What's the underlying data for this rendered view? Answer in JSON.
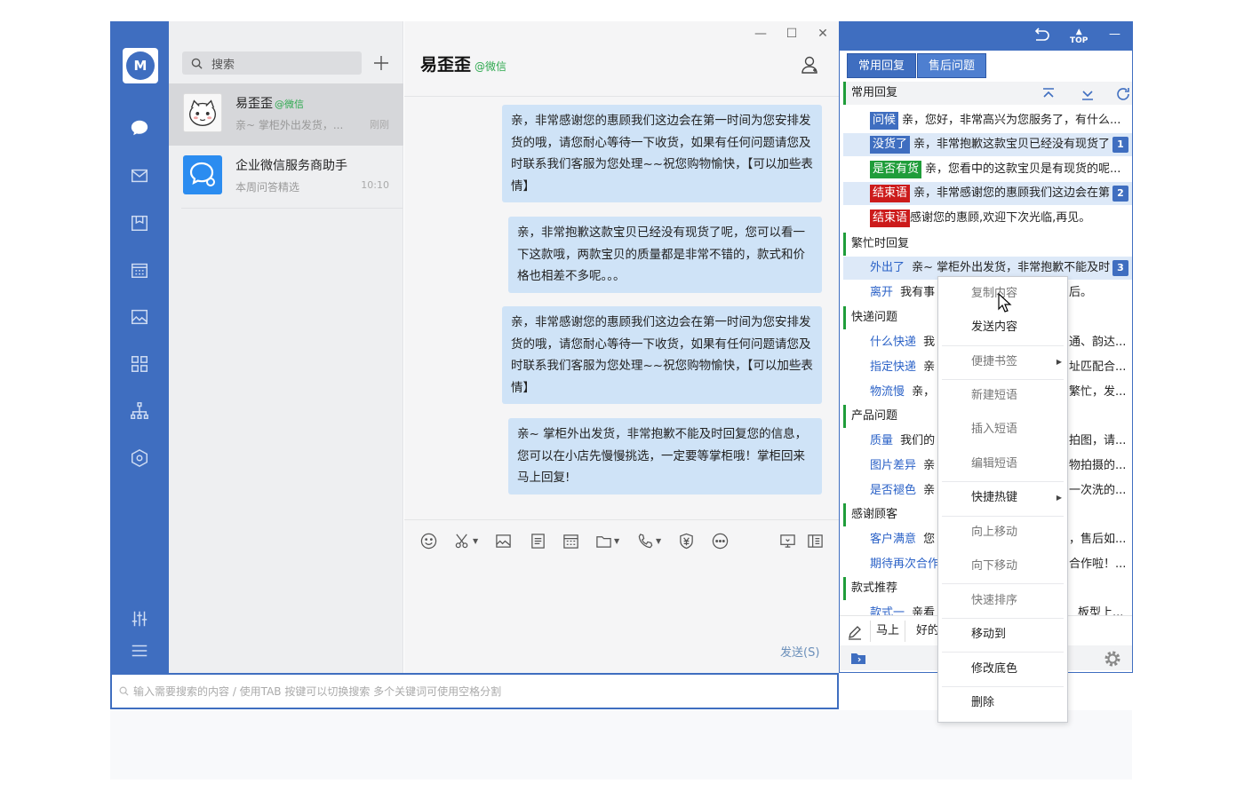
{
  "colors": {
    "accent": "#3f6ec0",
    "wechat_green": "#2ea94f",
    "bubble": "#cfe3f7",
    "tag_green": "#1f9d3a",
    "tag_red": "#cc1b1b"
  },
  "rail": {
    "logo": "M",
    "icons": [
      "chat-icon",
      "mail-icon",
      "box-icon",
      "calendar-icon",
      "image-icon",
      "apps-icon",
      "org-icon",
      "cube-icon",
      "sliders-icon",
      "menu-icon"
    ]
  },
  "convlist": {
    "search_placeholder": "搜索",
    "items": [
      {
        "name": "易歪歪",
        "tag": "@微信",
        "preview": "亲~ 掌柜外出发货，...",
        "time": "刚刚"
      },
      {
        "name": "企业微信服务商助手",
        "tag": "",
        "preview": "本周问答精选",
        "time": "10:10"
      }
    ]
  },
  "chat": {
    "title": "易歪歪",
    "title_tag": "@微信",
    "window_controls": [
      "—",
      "☐",
      "✕"
    ],
    "messages": [
      {
        "text": "亲，非常感谢您的惠顾我们这边会在第一时间为您安排发货的哦，请您耐心等待一下收货，如果有任何问题请您及时联系我们客服为您处理~~祝您购物愉快，【可以加些表情】"
      },
      {
        "text": "亲，非常抱歉这款宝贝已经没有现货了呢，您可以看一下这款哦，两款宝贝的质量都是非常不错的，款式和价格也相差不多呢。。。"
      },
      {
        "text": "亲，非常感谢您的惠顾我们这边会在第一时间为您安排发货的哦，请您耐心等待一下收货，如果有任何问题请您及时联系我们客服为您处理~~祝您购物愉快，【可以加些表情】"
      },
      {
        "text": "亲~ 掌柜外出发货，非常抱歉不能及时回复您的信息，您可以在小店先慢慢挑选，一定要等掌柜哦！掌柜回来马上回复!"
      }
    ],
    "send_label": "发送(S)"
  },
  "bottom_search": {
    "placeholder": "输入需要搜索的内容 / 使用TAB 按键可以切换搜索 多个关键词可使用空格分割"
  },
  "quick_reply": {
    "top_icons": [
      "exit-icon",
      "TOP",
      "—"
    ],
    "tabs": [
      "常用回复",
      "售后问题"
    ],
    "groups": [
      {
        "name": "常用回复",
        "items": [
          {
            "label": "问候",
            "style": "blue",
            "text": "亲，您好，非常高兴为您服务了，有什么...",
            "num": ""
          },
          {
            "label": "没货了",
            "style": "blue",
            "text": "亲，非常抱歉这款宝贝已经没有现货了",
            "num": "1"
          },
          {
            "label": "是否有货",
            "style": "green",
            "text": "亲，您看中的这款宝贝是有现货的呢...",
            "num": ""
          },
          {
            "label": "结束语",
            "style": "red",
            "text": "亲，非常感谢您的惠顾我们这边会在第",
            "num": "2"
          },
          {
            "label": "结束语",
            "style": "red",
            "text": "感谢您的惠顾,欢迎下次光临,再见。",
            "num": ""
          }
        ]
      },
      {
        "name": "繁忙时回复",
        "items": [
          {
            "label": "外出了",
            "style": "link",
            "text": "亲~ 掌柜外出发货，非常抱歉不能及时",
            "num": "3"
          },
          {
            "label": "离开",
            "style": "link",
            "text": "我有事",
            "tail": "后。",
            "num": ""
          }
        ]
      },
      {
        "name": "快递问题",
        "items": [
          {
            "label": "什么快递",
            "style": "link",
            "text": "我",
            "tail": "通、韵达...",
            "num": ""
          },
          {
            "label": "指定快递",
            "style": "link",
            "text": "亲",
            "tail": "址匹配合...",
            "num": ""
          },
          {
            "label": "物流慢",
            "style": "link",
            "text": "亲，",
            "tail": "繁忙，发...",
            "num": ""
          }
        ]
      },
      {
        "name": "产品问题",
        "items": [
          {
            "label": "质量",
            "style": "link",
            "text": "我们的",
            "tail": "拍图，请...",
            "num": ""
          },
          {
            "label": "图片差异",
            "style": "link",
            "text": "亲",
            "tail": "物拍摄的...",
            "num": ""
          },
          {
            "label": "是否褪色",
            "style": "link",
            "text": "亲",
            "tail": "一次洗的...",
            "num": ""
          }
        ]
      },
      {
        "name": "感谢顾客",
        "items": [
          {
            "label": "客户满意",
            "style": "link",
            "text": "您",
            "tail": "，售后如...",
            "num": ""
          },
          {
            "label": "期待再次合作",
            "style": "link",
            "text": "",
            "tail": "合作啦！...",
            "num": ""
          }
        ]
      },
      {
        "name": "款式推荐",
        "items": [
          {
            "label": "款式一",
            "style": "link",
            "text": "亲看",
            "tail": "板型上...",
            "num": ""
          }
        ]
      }
    ],
    "footer_words": [
      "马上",
      "好的"
    ]
  },
  "context_menu": {
    "items": [
      {
        "label": "复制内容",
        "dim": true,
        "submenu": false
      },
      {
        "label": "发送内容",
        "dim": false,
        "submenu": false
      },
      {
        "label": "便捷书签",
        "dim": true,
        "submenu": true
      },
      {
        "label": "新建短语",
        "dim": true,
        "submenu": false
      },
      {
        "label": "插入短语",
        "dim": true,
        "submenu": false
      },
      {
        "label": "编辑短语",
        "dim": true,
        "submenu": false
      },
      {
        "label": "快捷热键",
        "dim": false,
        "submenu": true
      },
      {
        "label": "向上移动",
        "dim": true,
        "submenu": false
      },
      {
        "label": "向下移动",
        "dim": true,
        "submenu": false
      },
      {
        "label": "快速排序",
        "dim": true,
        "submenu": false
      },
      {
        "label": "移动到",
        "dim": false,
        "submenu": false
      },
      {
        "label": "修改底色",
        "dim": false,
        "submenu": false
      },
      {
        "label": "删除",
        "dim": false,
        "submenu": false
      }
    ]
  }
}
